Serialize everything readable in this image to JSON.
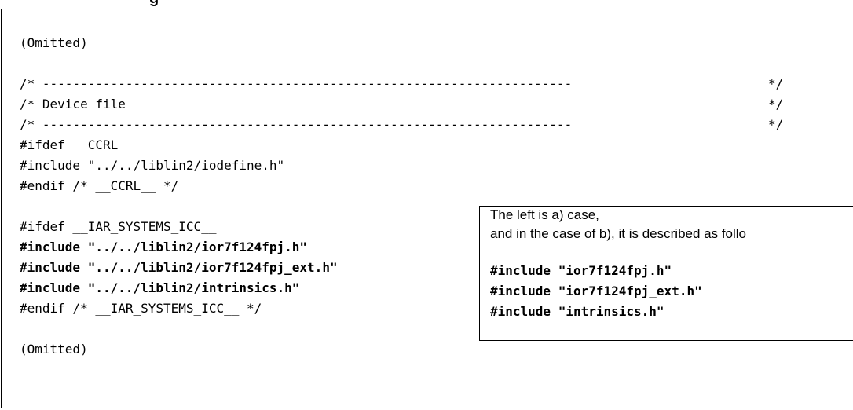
{
  "heading": "g",
  "code": {
    "omitted_top": "(Omitted)",
    "dash_start": "/* ----------------------------------------------------------------------",
    "dash_end": "*/",
    "device_file_comment": "/* Device file",
    "ifdef_ccrl": "#ifdef __CCRL__",
    "include_iodefine": "#include \"../../liblin2/iodefine.h\"",
    "endif_ccrl": "#endif /* __CCRL__ */",
    "ifdef_iar": "#ifdef __IAR_SYSTEMS_ICC__",
    "include_ior7f124fpj": "#include \"../../liblin2/ior7f124fpj.h\"",
    "include_ior7f124fpj_ext": "#include \"../../liblin2/ior7f124fpj_ext.h\"",
    "include_intrinsics": "#include \"../../liblin2/intrinsics.h\"",
    "endif_iar": "#endif /* __IAR_SYSTEMS_ICC__ */",
    "omitted_bottom": "(Omitted)"
  },
  "note": {
    "line1": "The left is a) case,",
    "line2": "and in the case of b), it is described as follo",
    "include1": "#include \"ior7f124fpj.h\"",
    "include2": "#include \"ior7f124fpj_ext.h\"",
    "include3": "#include \"intrinsics.h\""
  }
}
